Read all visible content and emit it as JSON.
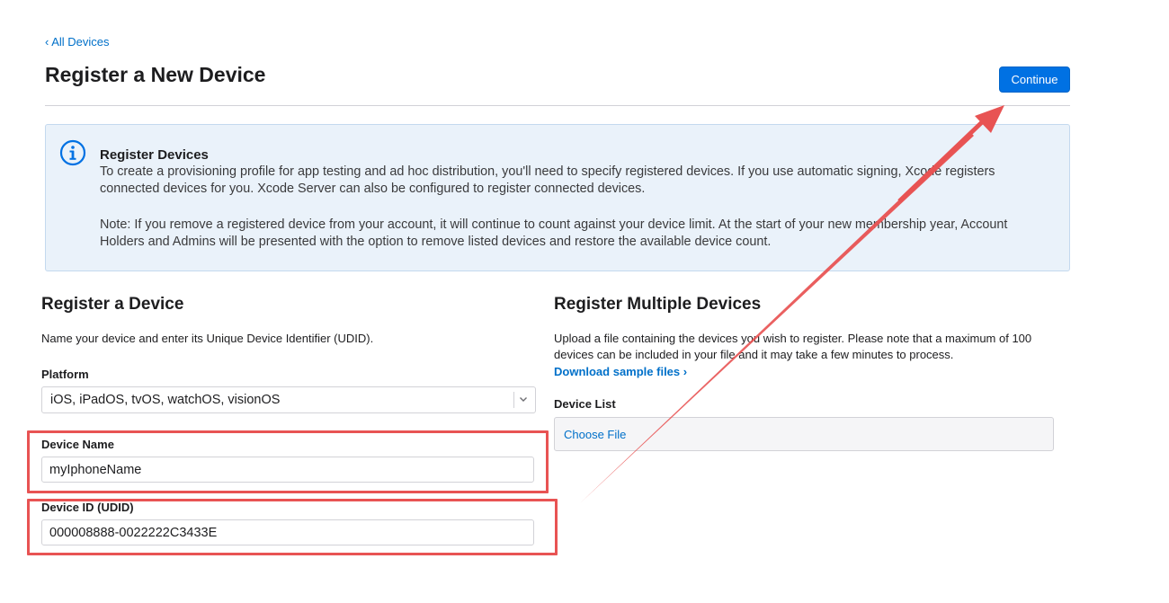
{
  "nav": {
    "back_label": "All Devices"
  },
  "header": {
    "title": "Register a New Device",
    "continue_label": "Continue"
  },
  "info": {
    "title": "Register Devices",
    "paragraph1": "To create a provisioning profile for app testing and ad hoc distribution, you'll need to specify registered devices. If you use automatic signing, Xcode registers connected devices for you. Xcode Server can also be configured to register connected devices.",
    "paragraph2": "Note: If you remove a registered device from your account, it will continue to count against your device limit. At the start of your new membership year, Account Holders and Admins will be presented with the option to remove listed devices and restore the available device count.",
    "icon": "info-circle-icon"
  },
  "single": {
    "title": "Register a Device",
    "description": "Name your device and enter its Unique Device Identifier (UDID).",
    "platform_label": "Platform",
    "platform_value": "iOS, iPadOS, tvOS, watchOS, visionOS",
    "name_label": "Device Name",
    "name_value": "myIphoneName",
    "udid_label": "Device ID (UDID)",
    "udid_value": "000008888-0022222C3433E"
  },
  "multiple": {
    "title": "Register Multiple Devices",
    "description": "Upload a file containing the devices you wish to register. Please note that a maximum of 100 devices can be included in your file and it may take a few minutes to process.",
    "sample_link": "Download sample files ›",
    "list_label": "Device List",
    "file_button": "Choose File"
  },
  "colors": {
    "accent": "#0071e3",
    "link": "#0070c9",
    "info_background": "#eaf2fa",
    "annotation": "#e85353"
  }
}
